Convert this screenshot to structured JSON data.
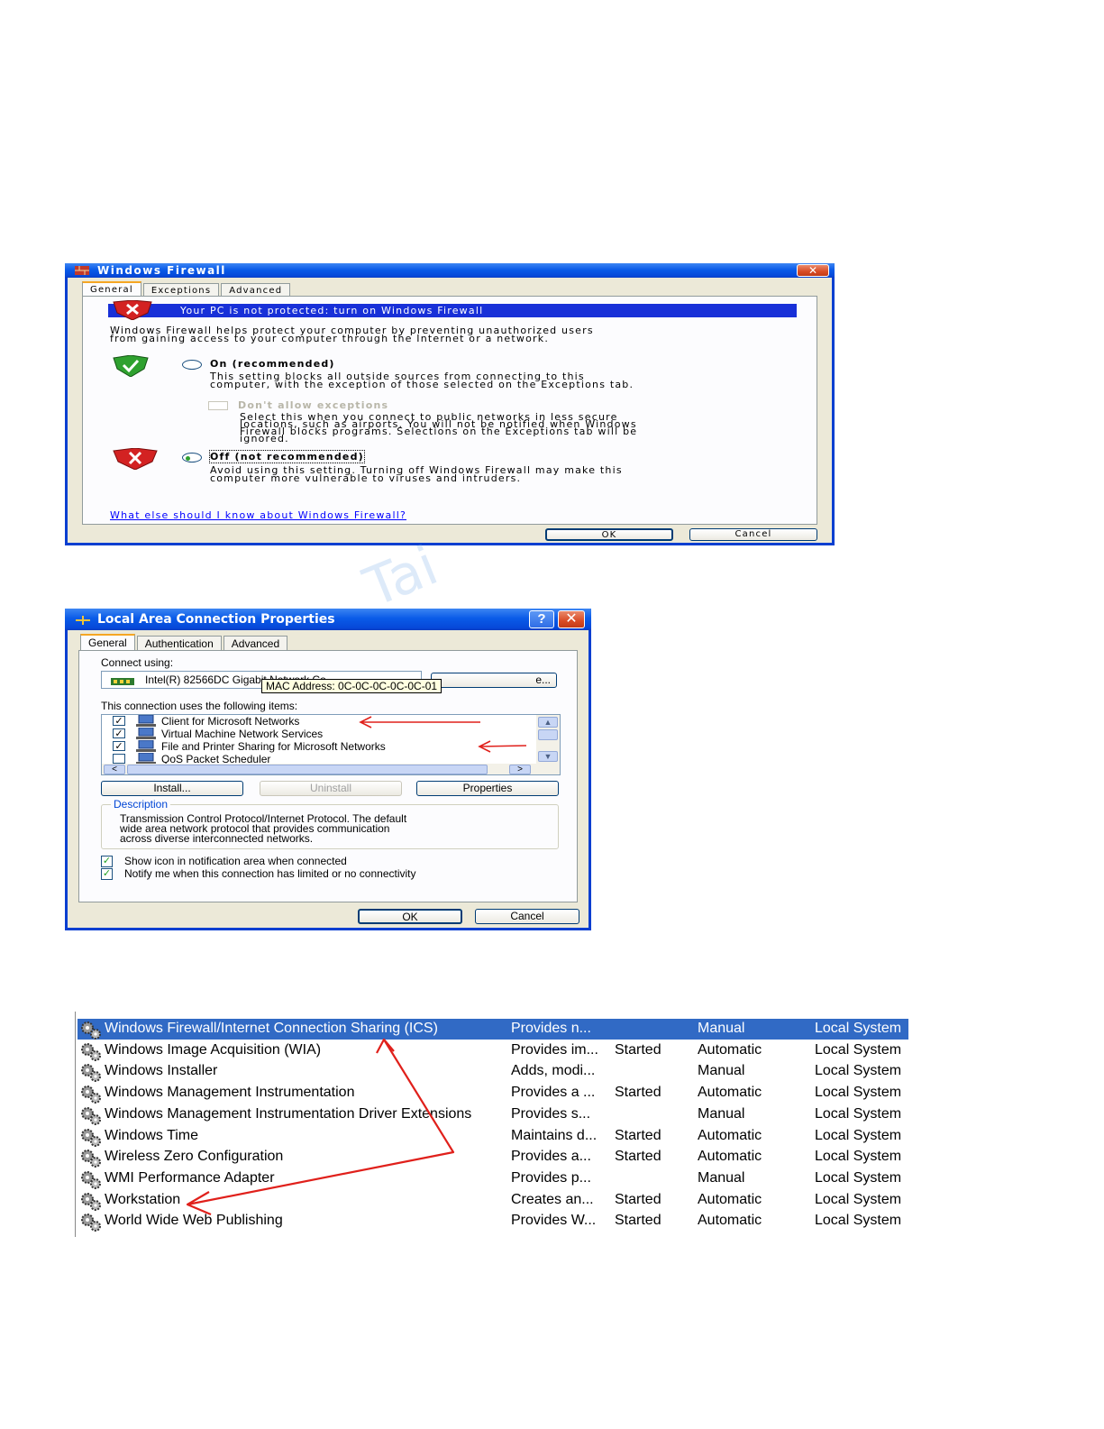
{
  "firewall": {
    "title": "Windows Firewall",
    "tabs": [
      "General",
      "Exceptions",
      "Advanced"
    ],
    "banner": "Your PC is not protected: turn on Windows Firewall",
    "intro": [
      "Windows Firewall helps protect your computer by preventing unauthorized users",
      "from gaining access to your computer through the Internet or a network."
    ],
    "on_label": "On (recommended)",
    "on_desc": [
      "This setting blocks all outside sources from connecting to this",
      "computer, with the exception of those selected on the Exceptions tab."
    ],
    "dont_allow_label": "Don't allow exceptions",
    "dont_allow_desc": [
      "Select this when you connect to public networks in less secure",
      "locations, such as airports. You will not be notified when Windows",
      "Firewall blocks programs. Selections on the Exceptions tab will be",
      "ignored."
    ],
    "off_label": "Off (not recommended)",
    "off_desc": [
      "Avoid using this setting. Turning off Windows Firewall may make this",
      "computer more vulnerable to viruses and intruders."
    ],
    "help_link": "What else should I know about Windows Firewall?",
    "ok": "OK",
    "cancel": "Cancel",
    "selected": "off"
  },
  "lan": {
    "title": "Local Area Connection Properties",
    "tabs": [
      "General",
      "Authentication",
      "Advanced"
    ],
    "connect_using": "Connect using:",
    "adapter": "Intel(R) 82566DC Gigabit Network Co",
    "configure_partial": "e...",
    "tooltip": "MAC Address: 0C-0C-0C-0C-0C-01",
    "items_label": "This connection uses the following items:",
    "items": [
      {
        "label": "Client for Microsoft Networks",
        "checked": true
      },
      {
        "label": "Virtual Machine Network Services",
        "checked": true
      },
      {
        "label": "File and Printer Sharing for Microsoft Networks",
        "checked": true
      },
      {
        "label": "QoS Packet Scheduler",
        "checked": false
      }
    ],
    "scroll_left": "<",
    "scroll_right": ">",
    "install": "Install...",
    "uninstall": "Uninstall",
    "properties": "Properties",
    "description_title": "Description",
    "description": [
      "Transmission Control Protocol/Internet Protocol. The default",
      "wide area network protocol that provides communication",
      "across diverse interconnected networks."
    ],
    "show_icon": "Show icon in notification area when connected",
    "notify": "Notify me when this connection has limited or no connectivity",
    "ok": "OK",
    "cancel": "Cancel"
  },
  "watermark": "Tai",
  "services": {
    "rows": [
      {
        "name": "Windows Firewall/Internet Connection Sharing (ICS)",
        "description": "Provides n...",
        "status": "",
        "startup": "Manual",
        "logon": "Local System",
        "selected": true
      },
      {
        "name": "Windows Image Acquisition (WIA)",
        "description": "Provides im...",
        "status": "Started",
        "startup": "Automatic",
        "logon": "Local System"
      },
      {
        "name": "Windows Installer",
        "description": "Adds, modi...",
        "status": "",
        "startup": "Manual",
        "logon": "Local System"
      },
      {
        "name": "Windows Management Instrumentation",
        "description": "Provides a ...",
        "status": "Started",
        "startup": "Automatic",
        "logon": "Local System"
      },
      {
        "name": "Windows Management Instrumentation Driver Extensions",
        "description": "Provides s...",
        "status": "",
        "startup": "Manual",
        "logon": "Local System"
      },
      {
        "name": "Windows Time",
        "description": "Maintains d...",
        "status": "Started",
        "startup": "Automatic",
        "logon": "Local System"
      },
      {
        "name": "Wireless Zero Configuration",
        "description": "Provides a...",
        "status": "Started",
        "startup": "Automatic",
        "logon": "Local System"
      },
      {
        "name": "WMI Performance Adapter",
        "description": "Provides p...",
        "status": "",
        "startup": "Manual",
        "logon": "Local System"
      },
      {
        "name": "Workstation",
        "description": "Creates an...",
        "status": "Started",
        "startup": "Automatic",
        "logon": "Local System"
      },
      {
        "name": "World Wide Web Publishing",
        "description": "Provides W...",
        "status": "Started",
        "startup": "Automatic",
        "logon": "Local System"
      }
    ]
  },
  "colors": {
    "xp_blue": "#0a5be8",
    "selection": "#316ac5",
    "annotation_red": "#e0201b",
    "dialog_bg": "#ece9d8"
  }
}
